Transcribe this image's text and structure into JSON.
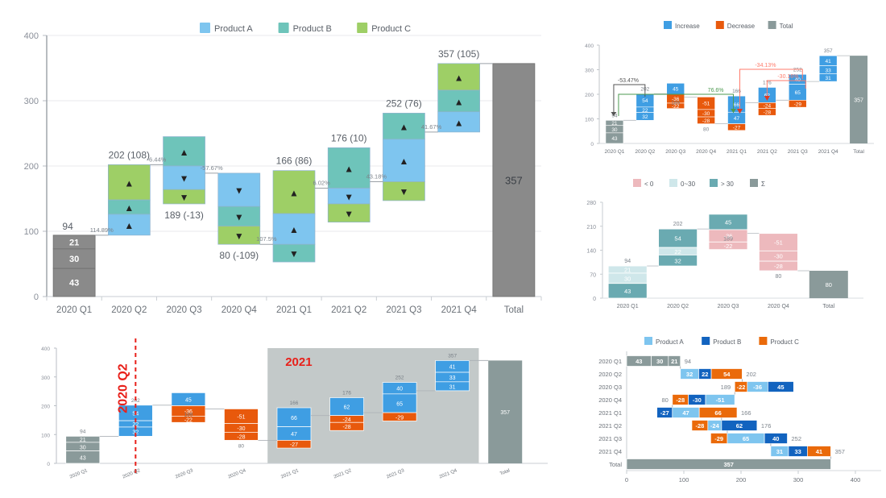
{
  "chart_data": [
    {
      "id": "main-waterfall",
      "type": "bar",
      "title": "",
      "subtype": "stacked-waterfall",
      "xlabel": "",
      "ylabel": "",
      "ylim": [
        0,
        400
      ],
      "yticks": [
        0,
        100,
        200,
        300,
        400
      ],
      "grid": true,
      "legend_position": "top",
      "legend": [
        {
          "label": "Product A",
          "color": "#7ec5ef"
        },
        {
          "label": "Product B",
          "color": "#6ec4ba"
        },
        {
          "label": "Product C",
          "color": "#9ecf66"
        }
      ],
      "categories": [
        "2020 Q1",
        "2020 Q2",
        "2020 Q3",
        "2020 Q4",
        "2021 Q1",
        "2021 Q2",
        "2021 Q3",
        "2021 Q4",
        "Total"
      ],
      "series": [
        {
          "name": "Product A",
          "values": [
            43,
            32,
            -36,
            -51,
            47,
            -24,
            65,
            31
          ]
        },
        {
          "name": "Product B",
          "values": [
            30,
            22,
            -22,
            -30,
            -27,
            -28,
            66,
            33
          ]
        },
        {
          "name": "Product C",
          "values": [
            21,
            54,
            45,
            -28,
            66,
            62,
            40,
            41
          ]
        }
      ],
      "cumulative": [
        94,
        202,
        189,
        80,
        166,
        176,
        252,
        357
      ],
      "total": 357,
      "total_label": "357",
      "top_labels": [
        "94",
        "202 (108)",
        "189 (-13)",
        "80 (-109)",
        "166 (86)",
        "176 (10)",
        "252 (76)",
        "357 (105)"
      ],
      "connector_percents": [
        "114.89%",
        "-6.44%",
        "-57.67%",
        "107.5%",
        "6.02%",
        "43.18%",
        "41.67%"
      ],
      "q1_segment_labels": [
        "21",
        "30",
        "43"
      ]
    },
    {
      "id": "top-right-waterfall",
      "type": "bar",
      "subtype": "stacked-waterfall",
      "ylim": [
        0,
        400
      ],
      "yticks": [
        0,
        100,
        200,
        300,
        400
      ],
      "legend_position": "top",
      "legend": [
        {
          "label": "Increase",
          "color": "#3f9ee3"
        },
        {
          "label": "Decrease",
          "color": "#e8590c"
        },
        {
          "label": "Total",
          "color": "#8a9a9a"
        }
      ],
      "categories": [
        "2020 Q1",
        "2020 Q2",
        "2020 Q3",
        "2020 Q4",
        "2021 Q1",
        "2021 Q2",
        "2021 Q3",
        "2021 Q4",
        "Total"
      ],
      "cumulative": [
        94,
        202,
        189,
        80,
        166,
        176,
        252,
        357
      ],
      "cum_labels": [
        "94",
        "202",
        "189",
        "80",
        "166",
        "176",
        "252",
        "357"
      ],
      "total_label": "357",
      "bars": [
        {
          "cat": "2020 Q1",
          "segments": [
            {
              "v": "21",
              "sign": "total"
            },
            {
              "v": "30",
              "sign": "total"
            },
            {
              "v": "43",
              "sign": "total"
            }
          ]
        },
        {
          "cat": "2020 Q2",
          "segments": [
            {
              "v": "54",
              "sign": "inc"
            },
            {
              "v": "22",
              "sign": "inc"
            },
            {
              "v": "32",
              "sign": "inc"
            }
          ]
        },
        {
          "cat": "2020 Q3",
          "segments": [
            {
              "v": "45",
              "sign": "inc"
            },
            {
              "v": "-36",
              "sign": "dec"
            },
            {
              "v": "-22",
              "sign": "dec"
            }
          ]
        },
        {
          "cat": "2020 Q4",
          "segments": [
            {
              "v": "-51",
              "sign": "dec"
            },
            {
              "v": "-30",
              "sign": "dec"
            },
            {
              "v": "-28",
              "sign": "dec"
            }
          ]
        },
        {
          "cat": "2021 Q1",
          "segments": [
            {
              "v": "66",
              "sign": "inc"
            },
            {
              "v": "47",
              "sign": "inc"
            },
            {
              "v": "-27",
              "sign": "dec"
            }
          ]
        },
        {
          "cat": "2021 Q2",
          "segments": [
            {
              "v": "62",
              "sign": "inc"
            },
            {
              "v": "-24",
              "sign": "dec"
            },
            {
              "v": "-28",
              "sign": "dec"
            }
          ]
        },
        {
          "cat": "2021 Q3",
          "segments": [
            {
              "v": "40",
              "sign": "inc"
            },
            {
              "v": "65",
              "sign": "inc"
            },
            {
              "v": "-29",
              "sign": "dec"
            }
          ]
        },
        {
          "cat": "2021 Q4",
          "segments": [
            {
              "v": "41",
              "sign": "inc"
            },
            {
              "v": "33",
              "sign": "inc"
            },
            {
              "v": "31",
              "sign": "inc"
            }
          ]
        }
      ],
      "annotations": [
        {
          "text": "-53.47%",
          "color": "#555555"
        },
        {
          "text": "76.6%",
          "color": "#2e7d32"
        },
        {
          "text": "-34.13%",
          "color": "#ff5a4d"
        },
        {
          "text": "-30.16%",
          "color": "#ff5a4d"
        }
      ]
    },
    {
      "id": "mid-right-waterfall",
      "type": "bar",
      "subtype": "stacked-waterfall",
      "ylim": [
        0,
        280
      ],
      "yticks": [
        0,
        70,
        140,
        210,
        280
      ],
      "legend_position": "top",
      "legend": [
        {
          "label": "< 0",
          "color": "#edb9bd"
        },
        {
          "label": "0~30",
          "color": "#cfe7ea"
        },
        {
          "label": "> 30",
          "color": "#6aaab1"
        },
        {
          "label": "Σ",
          "color": "#8a9a9a"
        }
      ],
      "categories": [
        "2020 Q1",
        "2020 Q2",
        "2020 Q3",
        "2020 Q4",
        "Total"
      ],
      "cum_labels": [
        "94",
        "202",
        "189",
        "80"
      ],
      "total_label": "80",
      "bars": [
        {
          "cat": "2020 Q1",
          "segments": [
            {
              "v": "21",
              "band": "mid"
            },
            {
              "v": "30",
              "band": "mid"
            },
            {
              "v": "43",
              "band": "high"
            }
          ]
        },
        {
          "cat": "2020 Q2",
          "segments": [
            {
              "v": "54",
              "band": "high"
            },
            {
              "v": "22",
              "band": "mid"
            },
            {
              "v": "32",
              "band": "high"
            }
          ]
        },
        {
          "cat": "2020 Q3",
          "segments": [
            {
              "v": "45",
              "band": "high"
            },
            {
              "v": "-36",
              "band": "neg"
            },
            {
              "v": "-22",
              "band": "neg"
            }
          ]
        },
        {
          "cat": "2020 Q4",
          "segments": [
            {
              "v": "-51",
              "band": "neg"
            },
            {
              "v": "-30",
              "band": "neg"
            },
            {
              "v": "-28",
              "band": "neg"
            }
          ]
        }
      ]
    },
    {
      "id": "bottom-left-waterfall",
      "type": "bar",
      "subtype": "stacked-waterfall",
      "ylim": [
        0,
        400
      ],
      "yticks": [
        0,
        100,
        200,
        300,
        400
      ],
      "categories": [
        "2020 Q1",
        "2020 Q2",
        "2020 Q3",
        "2020 Q4",
        "2021 Q1",
        "2021 Q2",
        "2021 Q3",
        "2021 Q4",
        "Total"
      ],
      "cum_labels": [
        "94",
        "202",
        "189",
        "80",
        "166",
        "176",
        "252",
        "357"
      ],
      "total_label": "357",
      "marker_line_label": "2020 Q2",
      "marker_line_color": "#e8201a",
      "region_label": "2021",
      "region_label_color": "#e8201a",
      "region_color": "#b9bfbf",
      "bars": [
        {
          "cat": "2020 Q1",
          "segments": [
            {
              "v": "21",
              "sign": "total"
            },
            {
              "v": "30",
              "sign": "total"
            },
            {
              "v": "43",
              "sign": "total"
            }
          ]
        },
        {
          "cat": "2020 Q2",
          "segments": [
            {
              "v": "54",
              "sign": "inc"
            },
            {
              "v": "22",
              "sign": "inc"
            },
            {
              "v": "32",
              "sign": "inc"
            }
          ]
        },
        {
          "cat": "2020 Q3",
          "segments": [
            {
              "v": "45",
              "sign": "inc"
            },
            {
              "v": "-36",
              "sign": "dec"
            },
            {
              "v": "-22",
              "sign": "dec"
            }
          ]
        },
        {
          "cat": "2020 Q4",
          "segments": [
            {
              "v": "-51",
              "sign": "dec"
            },
            {
              "v": "-30",
              "sign": "dec"
            },
            {
              "v": "-28",
              "sign": "dec"
            }
          ]
        },
        {
          "cat": "2021 Q1",
          "segments": [
            {
              "v": "66",
              "sign": "inc"
            },
            {
              "v": "47",
              "sign": "inc"
            },
            {
              "v": "-27",
              "sign": "dec"
            }
          ]
        },
        {
          "cat": "2021 Q2",
          "segments": [
            {
              "v": "62",
              "sign": "inc"
            },
            {
              "v": "-24",
              "sign": "dec"
            },
            {
              "v": "-28",
              "sign": "dec"
            }
          ]
        },
        {
          "cat": "2021 Q3",
          "segments": [
            {
              "v": "40",
              "sign": "inc"
            },
            {
              "v": "65",
              "sign": "inc"
            },
            {
              "v": "-29",
              "sign": "dec"
            }
          ]
        },
        {
          "cat": "2021 Q4",
          "segments": [
            {
              "v": "41",
              "sign": "inc"
            },
            {
              "v": "33",
              "sign": "inc"
            },
            {
              "v": "31",
              "sign": "inc"
            }
          ]
        }
      ]
    },
    {
      "id": "bottom-right-horizontal-waterfall",
      "type": "bar",
      "subtype": "horizontal-stacked-waterfall",
      "orientation": "horizontal",
      "xlim": [
        0,
        400
      ],
      "xticks": [
        0,
        100,
        200,
        300,
        400
      ],
      "legend_position": "top",
      "legend": [
        {
          "label": "Product A",
          "color": "#7ec5ef"
        },
        {
          "label": "Product B",
          "color": "#1263bf"
        },
        {
          "label": "Product C",
          "color": "#ea6a0a"
        }
      ],
      "categories": [
        "2020 Q1",
        "2020 Q2",
        "2020 Q3",
        "2020 Q4",
        "2021 Q1",
        "2021 Q2",
        "2021 Q3",
        "2021 Q4",
        "Total"
      ],
      "total_label": "357",
      "rows": [
        {
          "cat": "2020 Q1",
          "start": 0,
          "end": 94,
          "end_label": "94",
          "label_side": "right",
          "segments": [
            {
              "v": "43",
              "prod": "total"
            },
            {
              "v": "30",
              "prod": "total"
            },
            {
              "v": "21",
              "prod": "total"
            }
          ]
        },
        {
          "cat": "2020 Q2",
          "start": 94,
          "end": 202,
          "end_label": "202",
          "label_side": "right",
          "segments": [
            {
              "v": "32",
              "prod": "A"
            },
            {
              "v": "22",
              "prod": "B"
            },
            {
              "v": "54",
              "prod": "C"
            }
          ]
        },
        {
          "cat": "2020 Q3",
          "start": 189,
          "end": 202,
          "end_label": "189",
          "label_side": "left",
          "segments": [
            {
              "v": "-22",
              "prod": "C"
            },
            {
              "v": "-36",
              "prod": "A"
            },
            {
              "v": "45",
              "prod": "B"
            }
          ]
        },
        {
          "cat": "2020 Q4",
          "start": 80,
          "end": 189,
          "end_label": "80",
          "label_side": "left",
          "segments": [
            {
              "v": "-28",
              "prod": "C"
            },
            {
              "v": "-30",
              "prod": "B"
            },
            {
              "v": "-51",
              "prod": "A"
            }
          ]
        },
        {
          "cat": "2021 Q1",
          "start": 53,
          "end": 166,
          "end_label": "166",
          "label_side": "right",
          "segments": [
            {
              "v": "-27",
              "prod": "B"
            },
            {
              "v": "47",
              "prod": "A"
            },
            {
              "v": "66",
              "prod": "C"
            }
          ]
        },
        {
          "cat": "2021 Q2",
          "start": 114,
          "end": 176,
          "end_label": "176",
          "label_side": "right",
          "segments": [
            {
              "v": "-28",
              "prod": "C"
            },
            {
              "v": "-24",
              "prod": "A"
            },
            {
              "v": "62",
              "prod": "B"
            }
          ]
        },
        {
          "cat": "2021 Q3",
          "start": 147,
          "end": 252,
          "end_label": "252",
          "label_side": "right",
          "segments": [
            {
              "v": "-29",
              "prod": "C"
            },
            {
              "v": "65",
              "prod": "A"
            },
            {
              "v": "40",
              "prod": "B"
            }
          ]
        },
        {
          "cat": "2021 Q4",
          "start": 252,
          "end": 357,
          "end_label": "357",
          "label_side": "right",
          "segments": [
            {
              "v": "31",
              "prod": "A"
            },
            {
              "v": "33",
              "prod": "B"
            },
            {
              "v": "41",
              "prod": "C"
            }
          ]
        },
        {
          "cat": "Total",
          "start": 0,
          "end": 357,
          "end_label": "",
          "label_side": "none",
          "segments": [
            {
              "v": "357",
              "prod": "total"
            }
          ]
        }
      ]
    }
  ],
  "colors": {
    "product_a": "#7ec5ef",
    "product_b": "#6ec4ba",
    "product_c": "#9ecf66",
    "increase": "#3f9ee3",
    "decrease": "#e8590c",
    "total_grey": "#8a8a8a",
    "total_grey_soft": "#8a9a9a",
    "neg_pink": "#edb9bd",
    "band_low": "#cfe7ea",
    "band_high": "#6aaab1",
    "axis_text": "#8a8f99",
    "connector": "#9aa0a6",
    "accent_red": "#e8201a",
    "br_product_a": "#7ec5ef",
    "br_product_b": "#1263bf",
    "br_product_c": "#ea6a0a"
  },
  "glyphs": {
    "up": "▲",
    "down": "▼"
  }
}
